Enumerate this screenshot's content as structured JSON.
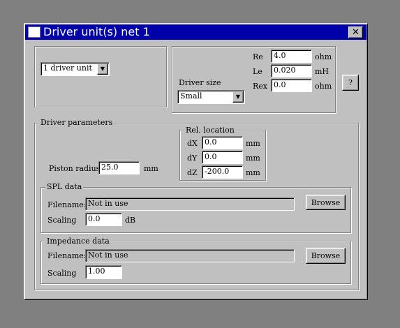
{
  "window": {
    "title": "Driver unit(s) net 1",
    "close_glyph": "✕"
  },
  "driver_count": {
    "selected": "1 driver unit"
  },
  "driver_size": {
    "label": "Driver size",
    "selected": "Small"
  },
  "electrical": {
    "re": {
      "label": "Re",
      "value": "4.0",
      "unit": "ohm"
    },
    "le": {
      "label": "Le",
      "value": "0.020",
      "unit": "mH"
    },
    "rex": {
      "label": "Rex",
      "value": "0.0",
      "unit": "ohm"
    }
  },
  "help_button": "?",
  "driver_parameters": {
    "group_label": "Driver parameters",
    "piston_radius": {
      "label": "Piston radius",
      "value": "25.0",
      "unit": "mm"
    },
    "rel_location": {
      "group_label": "Rel. location",
      "dx": {
        "label": "dX",
        "value": "0.0",
        "unit": "mm"
      },
      "dy": {
        "label": "dY",
        "value": "0.0",
        "unit": "mm"
      },
      "dz": {
        "label": "dZ",
        "value": "-200.0",
        "unit": "mm"
      }
    }
  },
  "spl_data": {
    "group_label": "SPL data",
    "filename_label": "Filename:",
    "filename_value": "Not in use",
    "browse_label": "Browse",
    "scaling_label": "Scaling",
    "scaling_value": "0.0",
    "scaling_unit": "dB"
  },
  "impedance_data": {
    "group_label": "Impedance data",
    "filename_label": "Filename:",
    "filename_value": "Not in use",
    "browse_label": "Browse",
    "scaling_label": "Scaling",
    "scaling_value": "1.00"
  },
  "colors": {
    "titlebar": "#0000a8",
    "dialog_face": "#c0c0c0",
    "desktop": "#808080"
  },
  "icons": {
    "dropdown": "triangle-down-icon",
    "close": "close-icon",
    "window": "window-icon"
  }
}
